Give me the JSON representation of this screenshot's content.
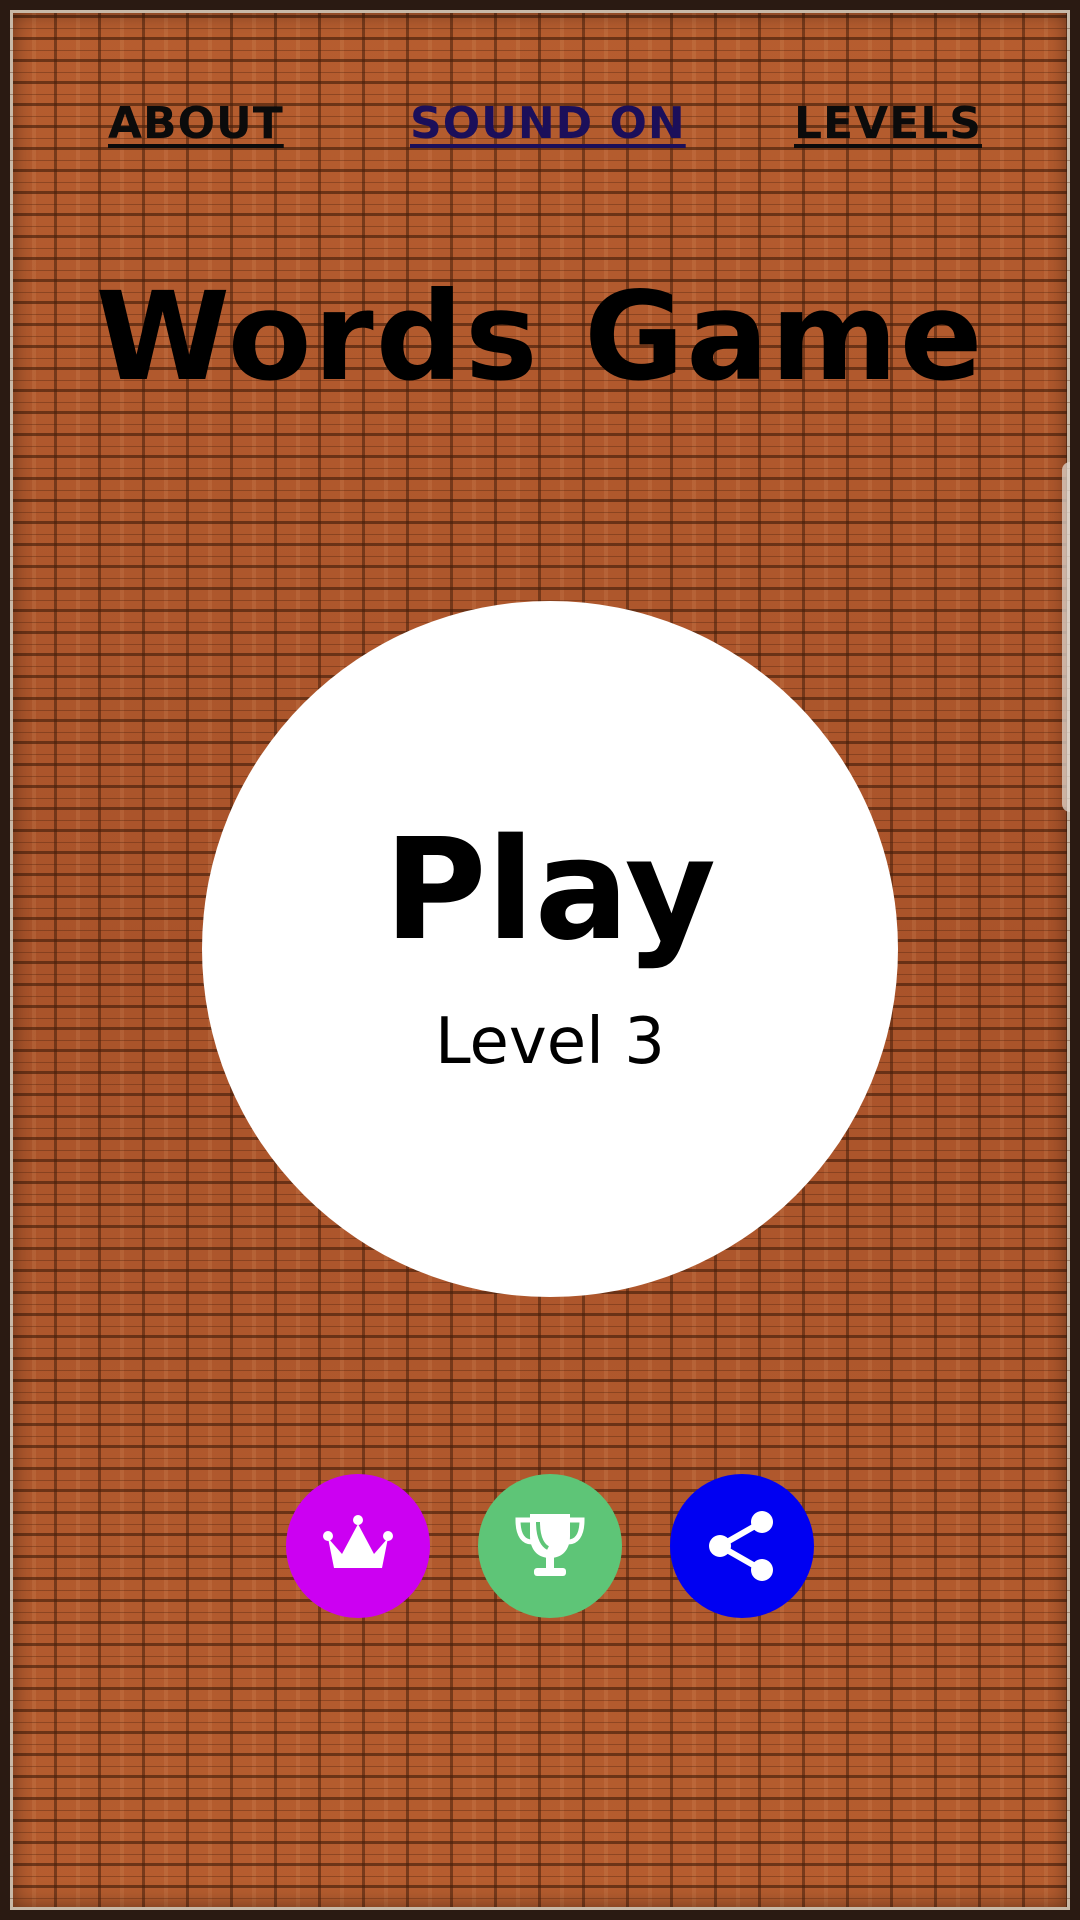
{
  "nav": {
    "about_label": "ABOUT",
    "sound_label": "SOUND ON",
    "levels_label": "LEVELS"
  },
  "title": "Words Game",
  "play": {
    "label": "Play",
    "level_label": "Level 3"
  },
  "actions": [
    {
      "icon": "crown-icon",
      "color": "#cc00f2"
    },
    {
      "icon": "trophy-icon",
      "color": "#5ec577"
    },
    {
      "icon": "share-icon",
      "color": "#0000f2"
    }
  ],
  "colors": {
    "brick": "#b2582c",
    "nav_text": "#0b0b0b",
    "sound_text": "#1b0f5a",
    "play_circle": "#ffffff"
  }
}
